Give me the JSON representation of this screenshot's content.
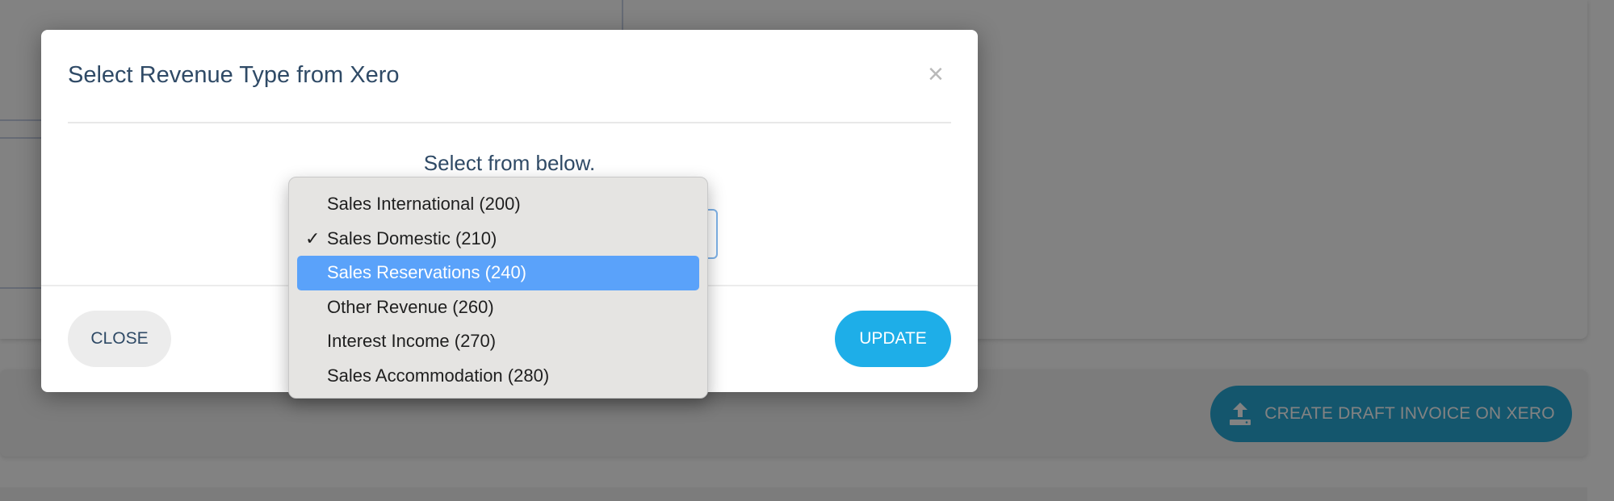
{
  "background": {
    "draft_button_label": "CREATE DRAFT INVOICE ON XERO"
  },
  "modal": {
    "title": "Select Revenue Type from Xero",
    "close_symbol": "×",
    "prompt": "Select from below.",
    "close_label": "CLOSE",
    "update_label": "UPDATE"
  },
  "dropdown": {
    "selected_index": 1,
    "highlighted_index": 2,
    "options": [
      {
        "label": "Sales International (200)"
      },
      {
        "label": "Sales Domestic (210)"
      },
      {
        "label": "Sales Reservations (240)"
      },
      {
        "label": "Other Revenue (260)"
      },
      {
        "label": "Interest Income (270)"
      },
      {
        "label": "Sales Accommodation (280)"
      }
    ]
  },
  "colors": {
    "title_text": "#2f4a66",
    "update_button": "#1eaee8",
    "draft_button": "#28a9d6",
    "highlight": "#5aa2fa"
  },
  "icons": {
    "draft_button_icon": "upload-icon",
    "checkmark": "check-icon"
  }
}
